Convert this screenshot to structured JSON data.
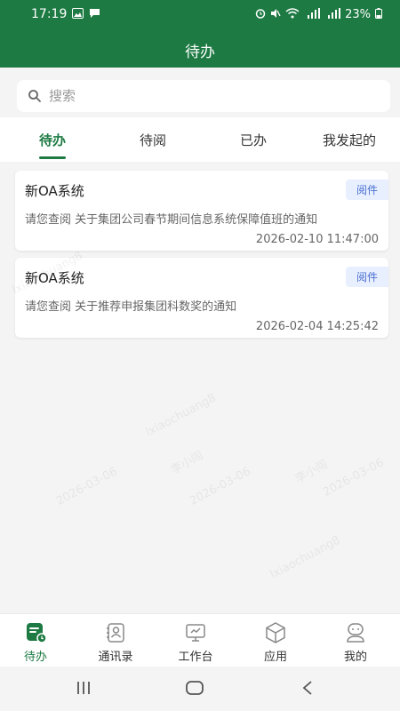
{
  "status_bar": {
    "time": "17:19",
    "battery": "23%"
  },
  "header": {
    "title": "待办"
  },
  "search": {
    "placeholder": "搜索"
  },
  "tabs": [
    {
      "label": "待办",
      "active": true
    },
    {
      "label": "待阅",
      "active": false
    },
    {
      "label": "已办",
      "active": false
    },
    {
      "label": "我发起的",
      "active": false
    }
  ],
  "cards": [
    {
      "title": "新OA系统",
      "badge": "阅件",
      "desc": "请您查阅 关于集团公司春节期间信息系统保障值班的通知",
      "time": "2026-02-10 11:47:00"
    },
    {
      "title": "新OA系统",
      "badge": "阅件",
      "desc": "请您查阅 关于推荐申报集团科数奖的通知",
      "time": "2026-02-04 14:25:42"
    }
  ],
  "watermark": {
    "user": "lxiaochuang8",
    "name": "李小闯",
    "date": "2026-03-06"
  },
  "bottom_nav": [
    {
      "label": "待办",
      "icon": "todo-icon",
      "active": true
    },
    {
      "label": "通讯录",
      "icon": "contacts-icon",
      "active": false
    },
    {
      "label": "工作台",
      "icon": "workbench-icon",
      "active": false
    },
    {
      "label": "应用",
      "icon": "apps-icon",
      "active": false
    },
    {
      "label": "我的",
      "icon": "profile-icon",
      "active": false
    }
  ],
  "colors": {
    "brand": "#1d7a43",
    "badge_bg": "#e8efff",
    "badge_text": "#4a6fd1"
  }
}
